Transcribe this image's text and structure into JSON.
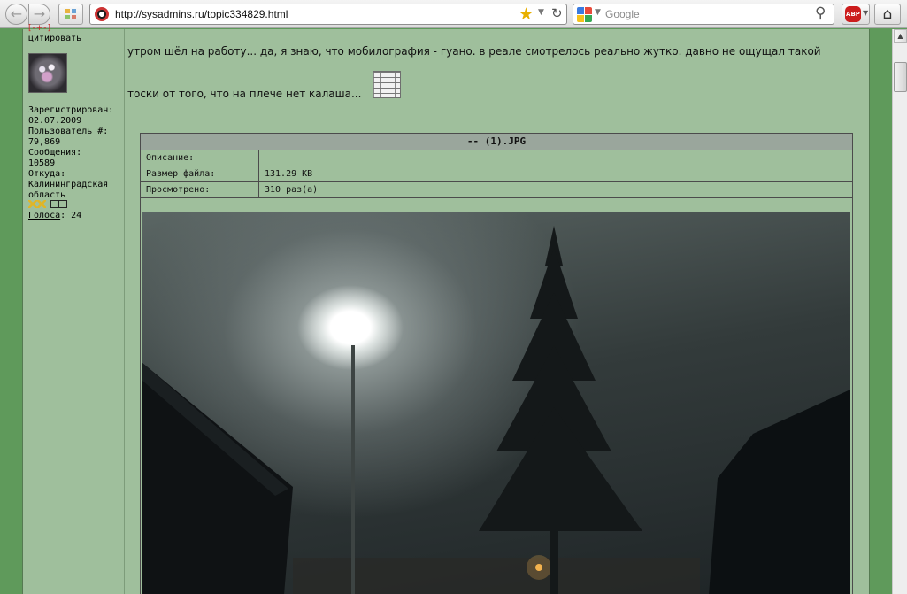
{
  "browser": {
    "url": "http://sysadmins.ru/topic334829.html",
    "search_placeholder": "Google",
    "abp_label": "ABP"
  },
  "user": {
    "rank": "[-+-]",
    "quote_link": "цитировать",
    "info_lines": [
      "Зарегистрирован:",
      "02.07.2009",
      "Пользователь #:",
      "79,869",
      "Сообщения:",
      "10589",
      "Откуда:",
      "Калининградская",
      "область"
    ],
    "votes_label": "Голоса",
    "votes_value": ": 24"
  },
  "post": {
    "line1": "утром шёл на работу... да, я знаю, что мобилография - гуано. в реале смотрелось реально жутко. давно не ощущал такой",
    "line2": "тоски от того, что на плече нет калаша..."
  },
  "attachment": {
    "title": "-- (1).JPG",
    "rows": [
      {
        "key": "Описание:",
        "value": ""
      },
      {
        "key": "Размер файла:",
        "value": "131.29 KB"
      },
      {
        "key": "Просмотрено:",
        "value": "310 раз(а)"
      }
    ]
  },
  "colors": {
    "page_bg": "#5f9a5b",
    "content_bg": "#9fbf9c",
    "header_bg": "#9aa69c"
  }
}
